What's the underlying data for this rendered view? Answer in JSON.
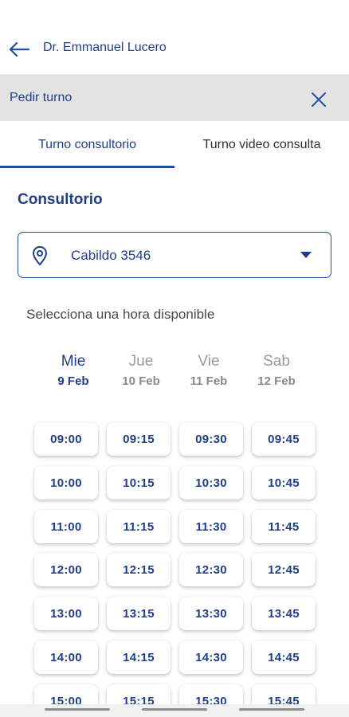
{
  "header": {
    "title": "Dr. Emmanuel Lucero",
    "back_icon": "arrow-left-icon"
  },
  "subheader": {
    "title": "Pedir turno",
    "close_icon": "close-icon"
  },
  "tabs": [
    {
      "label": "Turno consultorio",
      "active": true
    },
    {
      "label": "Turno video consulta",
      "active": false
    }
  ],
  "section_title": "Consultorio",
  "location_select": {
    "value": "Cabildo 3546",
    "icon": "location-pin-icon",
    "caret": "caret-down-icon"
  },
  "hint": "Selecciona una hora disponible",
  "days": [
    {
      "name": "Mie",
      "date": "9 Feb",
      "active": true
    },
    {
      "name": "Jue",
      "date": "10 Feb",
      "active": false
    },
    {
      "name": "Vie",
      "date": "11 Feb",
      "active": false
    },
    {
      "name": "Sab",
      "date": "12 Feb",
      "active": false
    }
  ],
  "slots": [
    [
      "09:00",
      "09:15",
      "09:30",
      "09:45"
    ],
    [
      "10:00",
      "10:15",
      "10:30",
      "10:45"
    ],
    [
      "11:00",
      "11:15",
      "11:30",
      "11:45"
    ],
    [
      "12:00",
      "12:15",
      "12:30",
      "12:45"
    ],
    [
      "13:00",
      "13:15",
      "13:30",
      "13:45"
    ],
    [
      "14:00",
      "14:15",
      "14:30",
      "14:45"
    ],
    [
      "15:00",
      "15:15",
      "15:30",
      "15:45"
    ]
  ],
  "colors": {
    "primary": "#1f3f8a",
    "accent": "#1f4f9f",
    "subheader_bg": "#e3e3e3"
  }
}
